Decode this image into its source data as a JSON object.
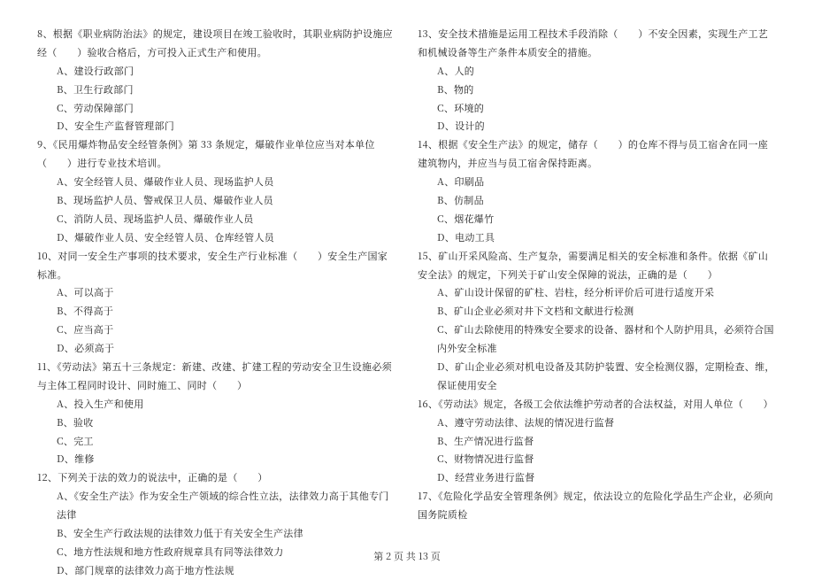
{
  "footer": "第 2 页 共 13 页",
  "questions": [
    {
      "id": "q8",
      "stem": "8、根据《职业病防治法》的规定，建设项目在竣工验收时，其职业病防护设施应经（　　）验收合格后，方可投入正式生产和使用。",
      "opts": [
        "A、建设行政部门",
        "B、卫生行政部门",
        "C、劳动保障部门",
        "D、安全生产监督管理部门"
      ]
    },
    {
      "id": "q9",
      "stem": "9、《民用爆炸物品安全经管条例》第 33 条规定，爆破作业单位应当对本单位（　　）进行专业技术培训。",
      "opts": [
        "A、安全经管人员、爆破作业人员、现场监护人员",
        "B、现场监护人员、警戒保卫人员、爆破作业人员",
        "C、消防人员、现场监护人员、爆破作业人员",
        "D、爆破作业人员、安全经管人员、仓库经管人员"
      ]
    },
    {
      "id": "q10",
      "stem": "10、对同一安全生产事项的技术要求，安全生产行业标准（　　）安全生产国家标准。",
      "opts": [
        "A、可以高于",
        "B、不得高于",
        "C、应当高于",
        "D、必须高于"
      ]
    },
    {
      "id": "q11",
      "stem": "11、《劳动法》第五十三条规定：新建、改建、扩建工程的劳动安全卫生设施必须与主体工程同时设计、同时施工、同时（　　）",
      "opts": [
        "A、投入生产和使用",
        "B、验收",
        "C、完工",
        "D、维修"
      ]
    },
    {
      "id": "q12",
      "stem": "12、下列关于法的效力的说法中，正确的是（　　）",
      "opts": [
        "A、《安全生产法》作为安全生产领域的综合性立法，法律效力高于其他专门法律",
        "B、安全生产行政法规的法律效力低于有关安全生产法律",
        "C、地方性法规和地方性政府规章具有同等法律效力",
        "D、部门规章的法律效力高于地方性法规"
      ]
    },
    {
      "id": "q13",
      "stem": "13、安全技术措施是运用工程技术手段消除（　　）不安全因素，实现生产工艺和机械设备等生产条件本质安全的措施。",
      "opts": [
        "A、人的",
        "B、物的",
        "C、环境的",
        "D、设计的"
      ]
    },
    {
      "id": "q14",
      "stem": "14、根据《安全生产法》的规定，储存（　　）的仓库不得与员工宿舍在同一座建筑物内，并应当与员工宿舍保持距离。",
      "opts": [
        "A、印刷品",
        "B、仿制品",
        "C、烟花爆竹",
        "D、电动工具"
      ]
    },
    {
      "id": "q15",
      "stem": "15、矿山开采风险高、生产复杂，需要满足相关的安全标准和条件。依据《矿山安全法》的规定，下列关于矿山安全保障的说法，正确的是（　　）",
      "opts": [
        "A、矿山设计保留的矿柱、岩柱，经分析评价后可进行适度开采",
        "B、矿山企业必须对井下文档和文献进行检测",
        "C、矿山去除使用的特殊安全要求的设备、器材和个人防护用具，必须符合国内外安全标准",
        "D、矿山企业必须对机电设备及其防护装置、安全检测仪器，定期检查、维，保证使用安全"
      ]
    },
    {
      "id": "q16",
      "stem": "16、《劳动法》规定，各级工会依法维护劳动者的合法权益，对用人单位（　　）",
      "opts": [
        "A、遵守劳动法律、法规的情况进行监督",
        "B、生产情况进行监督",
        "C、财物情况进行监督",
        "D、经营业务进行监督"
      ]
    },
    {
      "id": "q17",
      "stem": "17、《危险化学品安全管理条例》规定，依法设立的危险化学品生产企业，必须向国务院质检",
      "opts": []
    }
  ]
}
